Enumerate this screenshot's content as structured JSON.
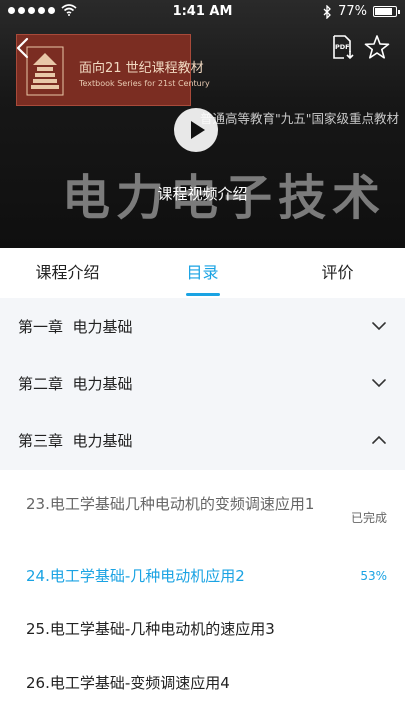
{
  "status_bar": {
    "time": "1:41 AM",
    "battery": "77%",
    "battery_level": 0.77,
    "icons": [
      "signal-dots-icon",
      "wifi-icon",
      "bluetooth-icon",
      "battery-icon"
    ]
  },
  "hero": {
    "logo_title": "面向21 世纪课程教材",
    "logo_subtitle": "Textbook Series for 21st Century",
    "subtitle": "普通高等教育\"九五\"国家级重点教材",
    "big_title": "电力电子技术",
    "play_label": "课程视频介绍",
    "icons": [
      "back-icon",
      "pdf-download-icon",
      "star-icon",
      "play-icon"
    ]
  },
  "tabs": [
    {
      "label": "课程介绍",
      "active": false
    },
    {
      "label": "目录",
      "active": true
    },
    {
      "label": "评价",
      "active": false
    }
  ],
  "chapters": [
    {
      "label": "第一章  电力基础",
      "expanded": false
    },
    {
      "label": "第二章  电力基础",
      "expanded": false
    },
    {
      "label": "第三章  电力基础",
      "expanded": true
    }
  ],
  "lessons": [
    {
      "title": "23.电工学基础几种电动机的变频调速应用1",
      "status": "已完成",
      "state": "done"
    },
    {
      "title": "24.电工学基础-几种电动机应用2",
      "status": "53%",
      "state": "current"
    },
    {
      "title": "25.电工学基础-几种电动机的速应用3",
      "status": "",
      "state": "normal"
    },
    {
      "title": "26.电工学基础-变频调速应用4",
      "status": "",
      "state": "normal"
    }
  ],
  "colors": {
    "accent": "#1aa3e3",
    "chapter_bg": "#f4f6f9",
    "logo_bg": "#7b2d22"
  }
}
